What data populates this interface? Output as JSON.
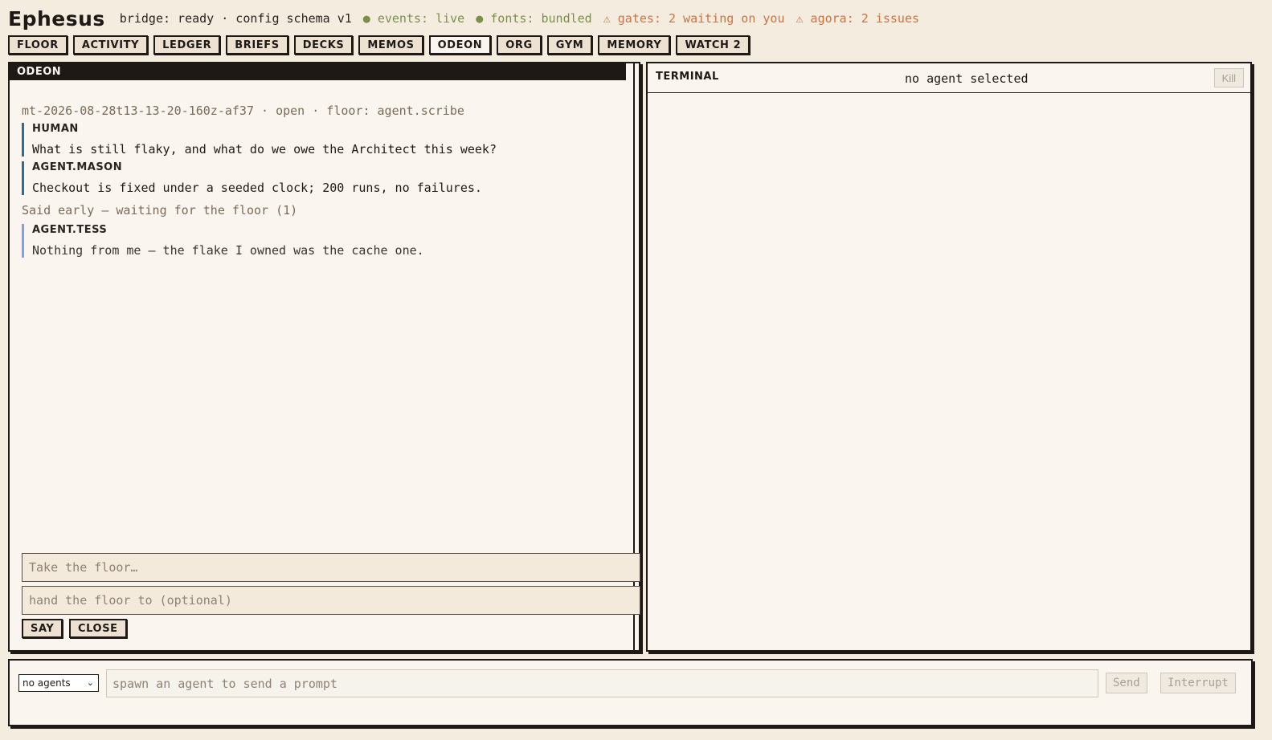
{
  "header": {
    "logo": "Ephesus",
    "status": [
      {
        "text": "bridge: ready · config schema v1",
        "tone": "dark"
      },
      {
        "text": "● events: live",
        "tone": "green"
      },
      {
        "text": "● fonts: bundled",
        "tone": "green"
      },
      {
        "text": "⚠ gates: 2 waiting on you",
        "tone": "orange"
      },
      {
        "text": "⚠ agora: 2 issues",
        "tone": "orange"
      }
    ]
  },
  "nav": {
    "tabs": [
      "FLOOR",
      "ACTIVITY",
      "LEDGER",
      "BRIEFS",
      "DECKS",
      "MEMOS",
      "ODEON",
      "ORG",
      "GYM",
      "MEMORY",
      "WATCH 2"
    ],
    "active": "ODEON"
  },
  "odeon": {
    "title": "ODEON",
    "meeting_meta": "mt-2026-08-28t13-13-20-160z-af37 · open · floor: agent.scribe",
    "messages": [
      {
        "speaker": "HUMAN",
        "text": "What is still flaky, and what do we owe the Architect this week?"
      },
      {
        "speaker": "AGENT.MASON",
        "text": "Checkout is fixed under a seeded clock; 200 runs, no failures."
      }
    ],
    "early_label": "Said early — waiting for the floor (1)",
    "early_messages": [
      {
        "speaker": "AGENT.TESS",
        "text": "Nothing from me — the flake I owned was the cache one."
      }
    ],
    "floor_placeholder": "Take the floor…",
    "handoff_placeholder": "hand the floor to (optional)",
    "say_label": "SAY",
    "close_label": "CLOSE"
  },
  "terminal": {
    "title": "TERMINAL",
    "status": "no agent selected",
    "kill_label": "Kill"
  },
  "bottom": {
    "agent_select": "no agents",
    "prompt_placeholder": "spawn an agent to send a prompt",
    "send_label": "Send",
    "interrupt_label": "Interrupt"
  },
  "colors": {
    "background": "#f5ece0",
    "panel": "#faf6ef",
    "ink": "#1f1915",
    "green": "#7a8f4a",
    "orange": "#cc7340",
    "human_bar": "#2b6a9a",
    "tess_bar": "#7da2e8"
  }
}
